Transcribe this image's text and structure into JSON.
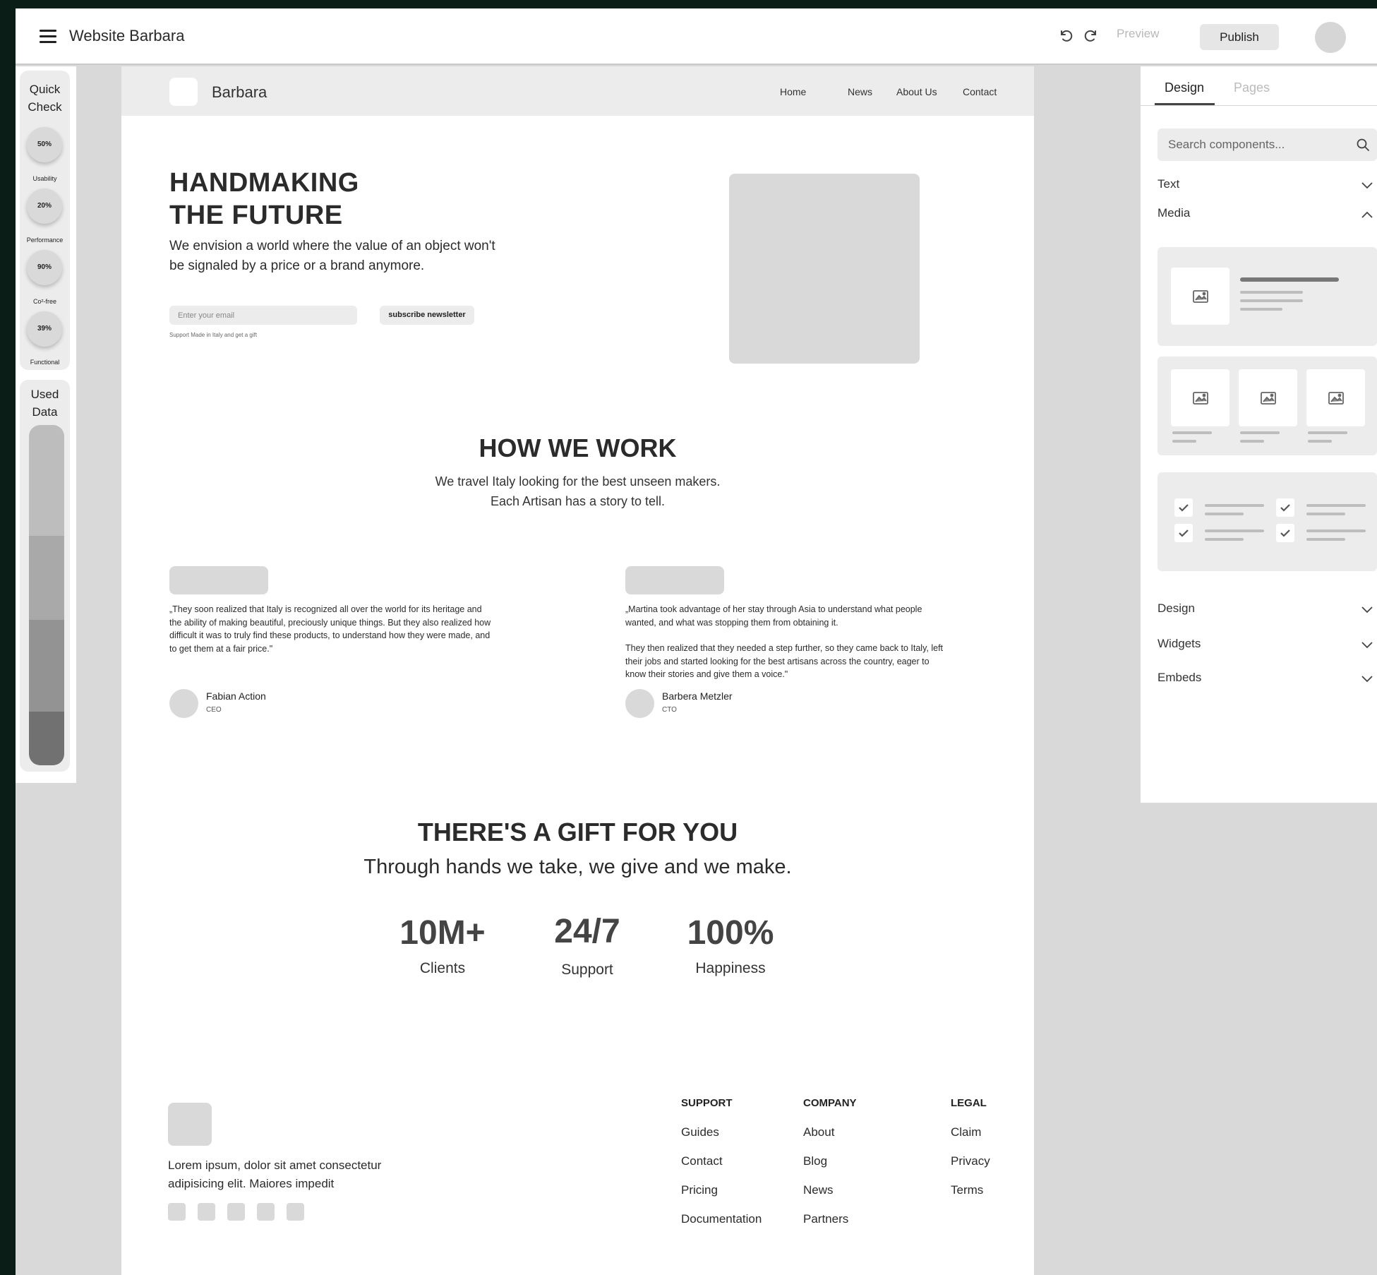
{
  "app": {
    "title": "Website Barbara",
    "preview_label": "Preview",
    "publish_label": "Publish"
  },
  "quick_check": {
    "title_line1": "Quick",
    "title_line2": "Check",
    "metrics": [
      {
        "value": "50%",
        "label": "Usability"
      },
      {
        "value": "20%",
        "label": "Performance"
      },
      {
        "value": "90%",
        "label": "Co²-free"
      },
      {
        "value": "39%",
        "label": "Functional"
      }
    ]
  },
  "used_data": {
    "title_line1": "Used",
    "title_line2": "Data",
    "colors": [
      "#bdbdbd",
      "#a9a9a9",
      "#939393",
      "#717171"
    ]
  },
  "site": {
    "brand": "Barbara",
    "nav": [
      "Home",
      "News",
      "About Us",
      "Contact"
    ],
    "hero": {
      "title_line1": "HANDMAKING",
      "title_line2": "THE FUTURE",
      "subtitle": "We envision a world where the value of an object won't be signaled by a price or a brand anymore.",
      "email_placeholder": "Enter your email",
      "subscribe_label": "subscribe newsletter",
      "note": "Support Made in Italy and get a gift"
    },
    "how_we_work": {
      "title": "HOW WE WORK",
      "subtitle_line1": "We travel Italy looking for the best unseen makers.",
      "subtitle_line2": "Each Artisan has a story to tell."
    },
    "testimonials": [
      {
        "quote_p1": "„They soon realized that Italy is recognized all over the world for its heritage and the ability of making beautiful, preciously unique things. But they also realized how difficult it was to truly find these products, to understand how they were made, and to get them at a fair price.\"",
        "quote_p2": "",
        "name": "Fabian Action",
        "role": "CEO"
      },
      {
        "quote_p1": "„Martina took advantage of her stay through Asia to understand what people wanted, and what was stopping them from obtaining it.",
        "quote_p2": "They then realized that they needed a step further, so they came back to Italy, left their jobs and started looking for the best artisans across the country, eager to know their stories and give them a voice.\"",
        "name": "Barbera Metzler",
        "role": "CTO"
      }
    ],
    "gift": {
      "title": "THERE'S A GIFT FOR YOU",
      "subtitle": "Through hands we take, we give and we make.",
      "stats": [
        {
          "value": "10M+",
          "label": "Clients"
        },
        {
          "value": "24/7",
          "label": "Support"
        },
        {
          "value": "100%",
          "label": "Happiness"
        }
      ]
    },
    "footer": {
      "text": "Lorem ipsum, dolor sit amet consectetur adipisicing elit. Maiores impedit",
      "columns": [
        {
          "heading": "SUPPORT",
          "links": [
            "Guides",
            "Contact",
            "Pricing",
            "Documentation"
          ]
        },
        {
          "heading": "COMPANY",
          "links": [
            "About",
            "Blog",
            "News",
            "Partners"
          ]
        },
        {
          "heading": "LEGAL",
          "links": [
            "Claim",
            "Privacy",
            "Terms"
          ]
        }
      ]
    }
  },
  "components_panel": {
    "tabs": [
      "Design",
      "Pages"
    ],
    "active_tab": "Design",
    "search_placeholder": "Search components...",
    "sections": [
      {
        "label": "Text",
        "expanded": false
      },
      {
        "label": "Media",
        "expanded": true
      },
      {
        "label": "Design",
        "expanded": false
      },
      {
        "label": "Widgets",
        "expanded": false
      },
      {
        "label": "Embeds",
        "expanded": false
      }
    ]
  }
}
